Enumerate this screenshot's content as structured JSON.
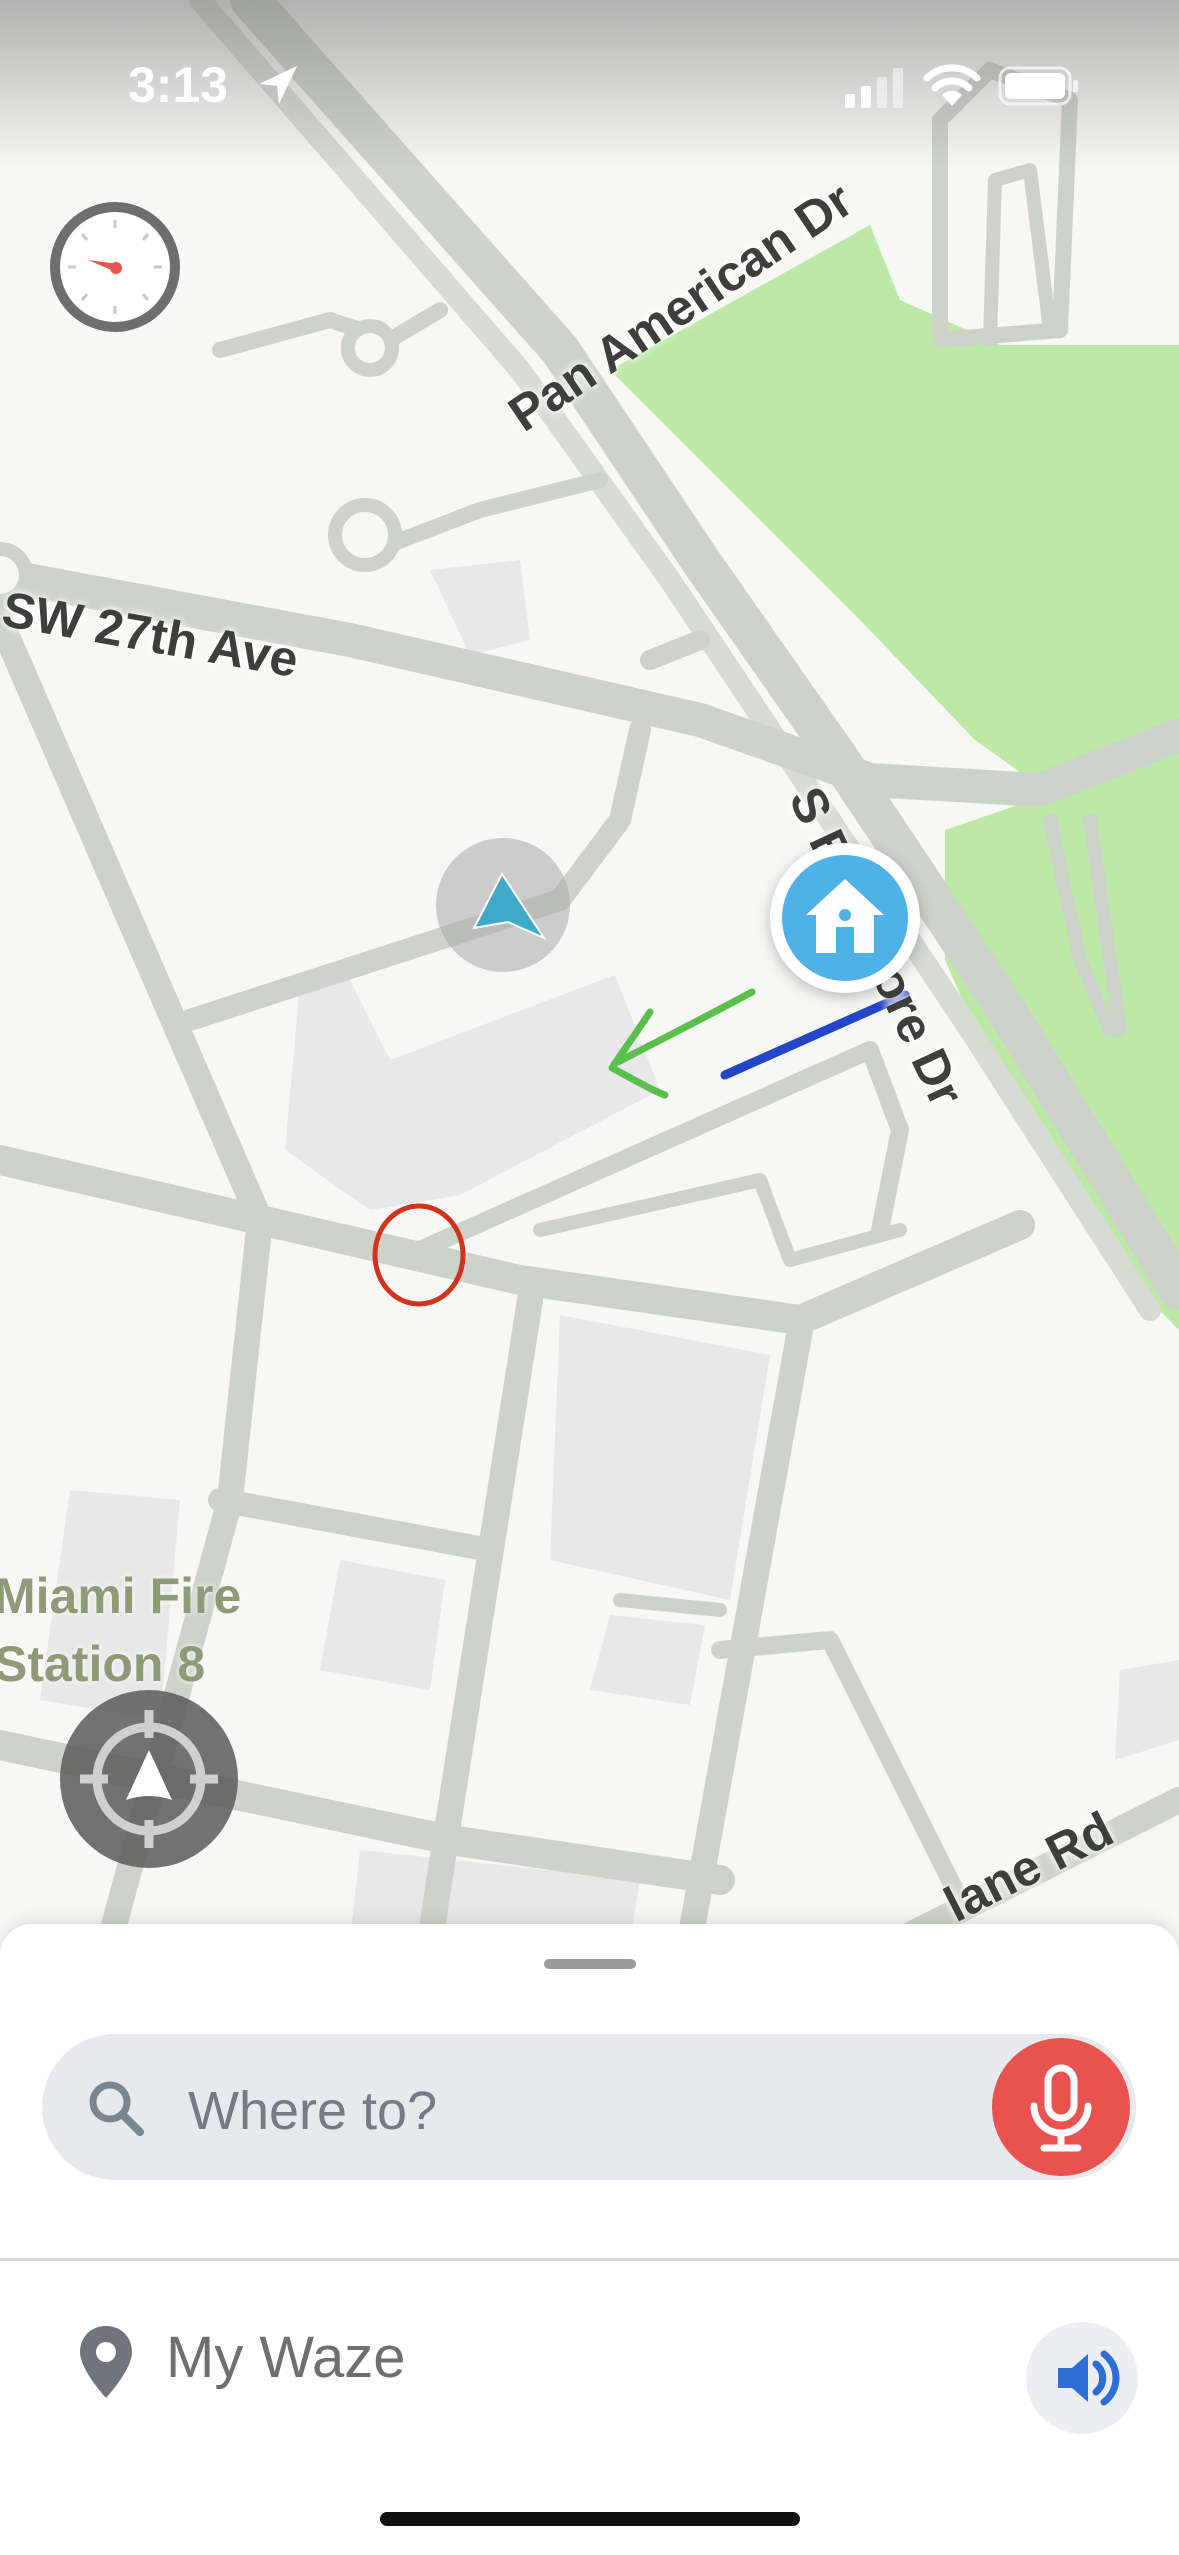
{
  "status_bar": {
    "time": "3:13"
  },
  "map": {
    "streets": {
      "pan_american": "Pan American Dr",
      "sw_27th": "SW 27th Ave",
      "s_bayshore": "S Bayshore Dr",
      "lane_rd": "lane Rd"
    },
    "poi": "Miami Fire Station 8",
    "colors": {
      "park": "#bde9a6",
      "road": "#cdd3cb",
      "building": "#e9e9e9",
      "route": "#2346c8",
      "annotation_arrow": "#5bbf4e",
      "annotation_circle": "#d1331f"
    }
  },
  "sheet": {
    "search_placeholder": "Where to?",
    "my_waze": "My Waze"
  },
  "icons": {
    "speedometer": "speedometer-icon",
    "recenter": "recenter-icon",
    "home": "home-icon",
    "user": "user-location-icon",
    "search": "search-icon",
    "mic": "microphone-icon",
    "pin": "location-pin-icon",
    "sound": "sound-icon"
  }
}
